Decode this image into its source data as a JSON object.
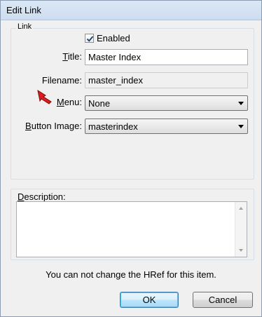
{
  "window": {
    "title": "Edit Link"
  },
  "link_group": {
    "label": "Link"
  },
  "enabled": {
    "label": "Enabled",
    "checked": true
  },
  "fields": {
    "title": {
      "label_pre": "",
      "label_u": "T",
      "label_post": "itle:",
      "value": "Master Index"
    },
    "filename": {
      "label": "Filename:",
      "value": "master_index"
    },
    "menu": {
      "label_u": "M",
      "label_post": "enu:",
      "value": "None"
    },
    "button_image": {
      "label_u": "B",
      "label_post": "utton Image:",
      "value": "masterindex"
    }
  },
  "description": {
    "label_u": "D",
    "label_post": "escription:",
    "value": ""
  },
  "info_text": "You can not change the HRef for this item.",
  "buttons": {
    "ok": "OK",
    "cancel": "Cancel"
  },
  "colors": {
    "pointer": "#d81e1e",
    "check": "#1c3e6a"
  }
}
